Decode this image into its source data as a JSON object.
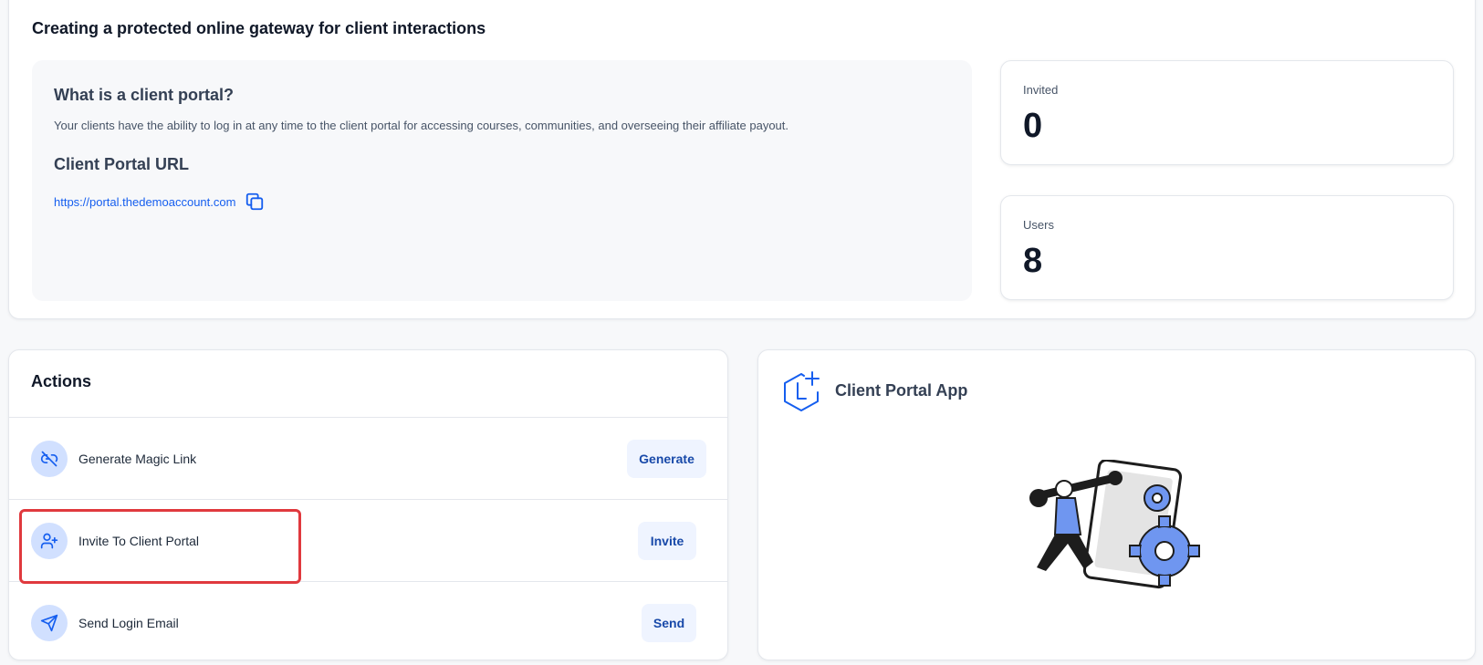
{
  "header": {
    "title": "Creating a protected online gateway for client interactions"
  },
  "info": {
    "what_heading": "What is a client portal?",
    "what_description": "Your clients have the ability to log in at any time to the client portal for accessing courses, communities, and overseeing their affiliate payout.",
    "url_heading": "Client Portal URL",
    "url": "https://portal.thedemoaccount.com",
    "copy_icon": "copy-icon"
  },
  "stats": {
    "invited": {
      "label": "Invited",
      "value": "0"
    },
    "users": {
      "label": "Users",
      "value": "8"
    }
  },
  "actions": {
    "title": "Actions",
    "items": [
      {
        "label": "Generate Magic Link",
        "button": "Generate",
        "icon": "link-icon"
      },
      {
        "label": "Invite To Client Portal",
        "button": "Invite",
        "icon": "user-plus-icon"
      },
      {
        "label": "Send Login Email",
        "button": "Send",
        "icon": "send-icon"
      }
    ]
  },
  "app": {
    "title": "Client Portal App",
    "logo_icon": "client-portal-logo-icon",
    "illustration": "person-with-wrench-and-gears-illustration"
  },
  "colors": {
    "accent": "#155eef",
    "button_bg": "#eff4ff",
    "icon_bg": "#d1e0ff",
    "highlight": "#e0393e"
  }
}
